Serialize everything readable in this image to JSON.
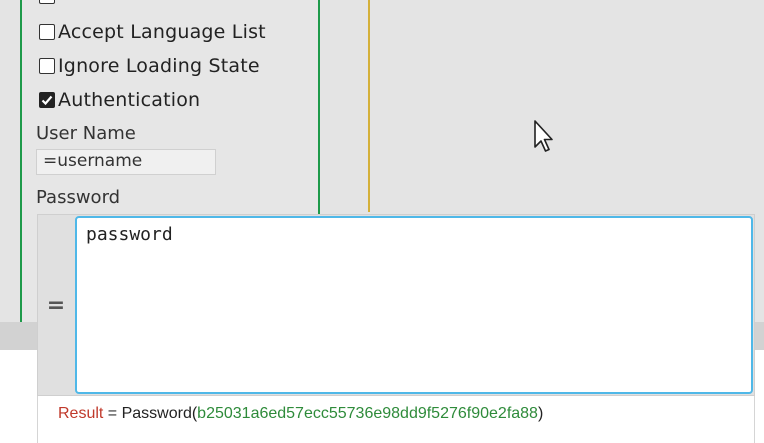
{
  "options": {
    "accept_language_list": {
      "label": "Accept Language List",
      "checked": false
    },
    "ignore_loading_state": {
      "label": "Ignore Loading State",
      "checked": false
    },
    "authentication": {
      "label": "Authentication",
      "checked": true
    }
  },
  "fields": {
    "user_name": {
      "label": "User Name",
      "value": "=username"
    },
    "password": {
      "label": "Password"
    }
  },
  "editor": {
    "gutter_symbol": "=",
    "content": "password"
  },
  "result": {
    "prefix": "Result",
    "equals": " = ",
    "function": "Password",
    "open_paren": "(",
    "hash": "b25031a6ed57ecc55736e98dd9f5276f90e2fa88",
    "close_paren": ")"
  },
  "colors": {
    "panel_border": "#1e9a4a",
    "separator": "#d4b03a",
    "focus_border": "#4fb8e8",
    "result_label": "#c0392b",
    "result_hash": "#2e8b3a"
  },
  "icons": {
    "cursor": "mouse-pointer-icon",
    "checkmark": "checkmark-icon"
  }
}
